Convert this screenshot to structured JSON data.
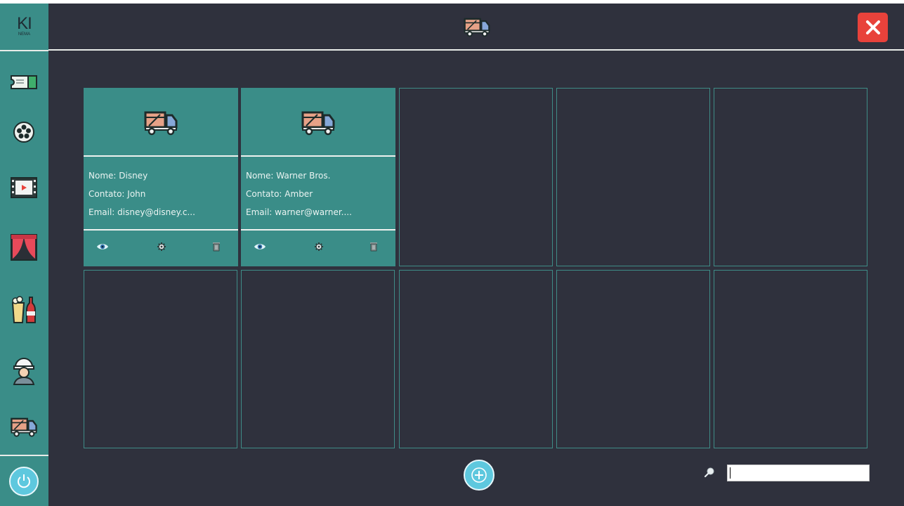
{
  "logo": {
    "text": "KI",
    "subtext": "NEMA"
  },
  "sidebar": {
    "items": [
      {
        "icon": "ticket-icon"
      },
      {
        "icon": "film-reel-icon"
      },
      {
        "icon": "video-player-icon"
      },
      {
        "icon": "theater-curtain-icon"
      },
      {
        "icon": "snacks-icon"
      },
      {
        "icon": "worker-icon"
      },
      {
        "icon": "delivery-truck-icon"
      }
    ],
    "power_icon": "power-icon"
  },
  "header": {
    "icon": "delivery-truck-icon",
    "close_icon": "close-icon"
  },
  "cards": [
    {
      "nome": "Nome: Disney",
      "contato": "Contato: John",
      "email": "Email: disney@disney.c..."
    },
    {
      "nome": "Nome: Warner Bros.",
      "contato": "Contato: Amber",
      "email": "Email: warner@warner...."
    }
  ],
  "card_actions": [
    "eye-icon",
    "gear-icon",
    "trash-icon"
  ],
  "footer": {
    "add_icon": "plus-icon",
    "search_icon": "search-icon",
    "search_value": ""
  },
  "colors": {
    "background": "#2f313d",
    "accent": "#3a8d88",
    "close": "#e8423b",
    "button": "#5ec8de"
  }
}
